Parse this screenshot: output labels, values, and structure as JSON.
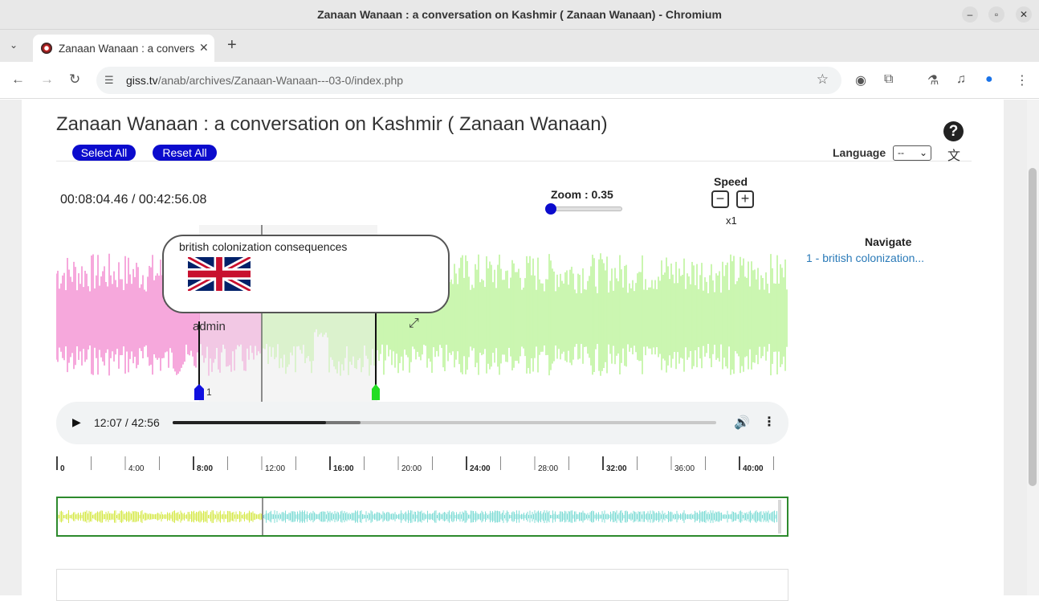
{
  "window": {
    "title": "Zanaan Wanaan : a conversation on Kashmir ( Zanaan Wanaan) - Chromium"
  },
  "tab": {
    "title": "Zanaan Wanaan : a conversation on Kashmir"
  },
  "address": {
    "domain": "giss.tv",
    "path": "/anab/archives/Zanaan-Wanaan---03-0/index.php"
  },
  "page": {
    "title": "Zanaan Wanaan : a conversation on Kashmir ( Zanaan Wanaan)",
    "select_all": "Select All",
    "reset_all": "Reset All",
    "language_label": "Language",
    "language_value": "--",
    "help": "?"
  },
  "player": {
    "position": "00:08:04.46 / 00:42:56.08",
    "zoom_label": "Zoom : 0.35",
    "zoom_value": 0.35,
    "speed_label": "Speed",
    "speed_value": "x1",
    "annotation": {
      "title": "british colonization consequences",
      "author": "admin",
      "marker_number": "1"
    },
    "audio": {
      "current_time": "12:07 / 42:56",
      "played_fraction": 0.282,
      "buffered_fraction": 0.345
    },
    "ruler_labels": [
      "0",
      "4:00",
      "8:00",
      "12:00",
      "16:00",
      "20:00",
      "24:00",
      "28:00",
      "32:00",
      "36:00",
      "40:00"
    ]
  },
  "navigate": {
    "heading": "Navigate",
    "items": [
      "1 - british colonization..."
    ]
  },
  "colors": {
    "accent": "#0b0bcd",
    "wave_played": "#ee55bb",
    "wave_unplayed": "#99ee66",
    "mini_played": "#d6e94a",
    "mini_unplayed": "#7fdcd6",
    "link": "#2a7ab8"
  }
}
